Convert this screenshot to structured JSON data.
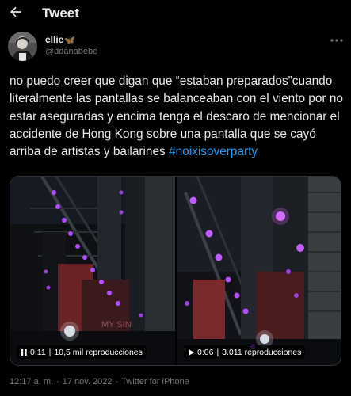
{
  "header": {
    "title": "Tweet"
  },
  "author": {
    "name": "ellie",
    "name_emoji": "🦋",
    "handle": "@ddanabebe"
  },
  "tweet": {
    "text": "no puedo creer que digan que “estaban preparados”cuando literalmente las pantallas se balanceaban con el viento por no estar aseguradas y encima tenga el descaro de mencionar el accidente de Hong Kong sobre una pantalla que se cayó arriba de artistas y bailarines ",
    "hashtag": "#noixisoverparty"
  },
  "media": [
    {
      "time": "0:11",
      "views": "10,5 mil reproducciones",
      "state_icon": "pause-icon"
    },
    {
      "time": "0:06",
      "views": "3.011 reproducciones",
      "state_icon": "play-icon"
    }
  ],
  "meta": {
    "time": "12:17 a. m.",
    "date": "17 nov. 2022",
    "source": "Twitter for iPhone",
    "separator": "·"
  },
  "colors": {
    "background": "#000000",
    "text": "#e7e9ea",
    "muted": "#71767b",
    "accent": "#1d9bf0",
    "light": "#b44cff"
  }
}
